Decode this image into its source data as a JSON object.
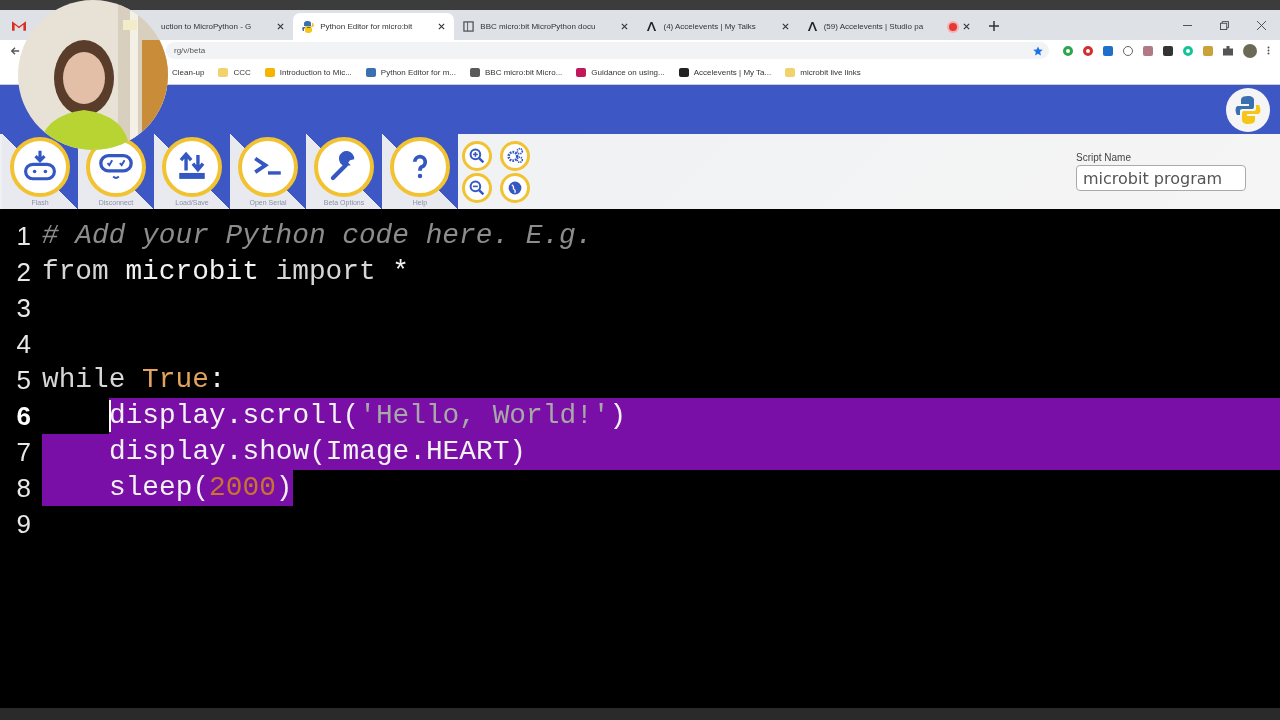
{
  "browser": {
    "tabs": [
      {
        "title": "uction to MicroPython - G",
        "kind": "slides",
        "selected": false,
        "recording": false
      },
      {
        "title": "Python Editor for micro:bit",
        "kind": "python",
        "selected": true,
        "recording": false
      },
      {
        "title": "BBC micro:bit MicroPython docu",
        "kind": "docs",
        "selected": false,
        "recording": false
      },
      {
        "title": "(4) Accelevents | My Talks",
        "kind": "accelevents",
        "selected": false,
        "recording": false
      },
      {
        "title": "(59) Accelevents | Studio pa",
        "kind": "accelevents",
        "selected": false,
        "recording": true
      }
    ],
    "address": "rg/v/beta",
    "bookmarks": [
      {
        "label": "Clean-up",
        "kind": "plain"
      },
      {
        "label": "CCC",
        "kind": "folder"
      },
      {
        "label": "Introduction to Mic...",
        "kind": "slides"
      },
      {
        "label": "Python Editor for m...",
        "kind": "python"
      },
      {
        "label": "BBC micro:bit Micro...",
        "kind": "docs"
      },
      {
        "label": "Guidance on using...",
        "kind": "link"
      },
      {
        "label": "Accelevents | My Ta...",
        "kind": "accelevents"
      },
      {
        "label": "microbit live links",
        "kind": "folder"
      }
    ]
  },
  "toolbar": {
    "buttons": [
      {
        "label": "Flash",
        "kind": "flash"
      },
      {
        "label": "Disconnect",
        "kind": "robot"
      },
      {
        "label": "Load/Save",
        "kind": "loadsave"
      },
      {
        "label": "Open Serial",
        "kind": "serial"
      },
      {
        "label": "Beta Options",
        "kind": "wrench"
      },
      {
        "label": "Help",
        "kind": "help"
      }
    ],
    "small_buttons": [
      {
        "kind": "zoom-in"
      },
      {
        "kind": "settings"
      },
      {
        "kind": "zoom-out"
      },
      {
        "kind": "globe"
      }
    ],
    "script_name": {
      "label": "Script Name",
      "value": "microbit program"
    }
  },
  "editor": {
    "lines": [
      {
        "number": "1",
        "indent": false,
        "selected": false,
        "cursor": false,
        "tokens": [
          {
            "text": "# Add your Python code here. E.g.",
            "kind": "comment"
          }
        ]
      },
      {
        "number": "2",
        "indent": false,
        "selected": false,
        "cursor": false,
        "tokens": [
          {
            "text": "from",
            "kind": "keyword"
          },
          {
            "text": " microbit ",
            "kind": "name"
          },
          {
            "text": "import",
            "kind": "keyword"
          },
          {
            "text": " *",
            "kind": "name"
          }
        ]
      },
      {
        "number": "3",
        "selected": false,
        "cursor": false
      },
      {
        "number": "4",
        "selected": false,
        "cursor": false
      },
      {
        "number": "5",
        "indent": false,
        "selected": false,
        "cursor": false,
        "tokens": [
          {
            "text": "while",
            "kind": "keyword"
          },
          {
            "text": " True",
            "kind": "constant"
          },
          {
            "text": ":",
            "kind": "name"
          }
        ]
      },
      {
        "number": "6",
        "indent": true,
        "selected": true,
        "cursor": true,
        "tokens": [
          {
            "text": "display.scroll(",
            "kind": "name"
          },
          {
            "text": "'Hello, World!'",
            "kind": "string"
          },
          {
            "text": ")",
            "kind": "name"
          }
        ]
      },
      {
        "number": "7",
        "indent": true,
        "selected": true,
        "cursor": false,
        "tokens": [
          {
            "text": "display.show(Image.HEART)",
            "kind": "name"
          }
        ]
      },
      {
        "number": "8",
        "indent": true,
        "selected": true,
        "cursor": false,
        "tokens": [
          {
            "text": "sleep(",
            "kind": "name"
          },
          {
            "text": "2000",
            "kind": "number"
          },
          {
            "text": ")",
            "kind": "name"
          }
        ]
      },
      {
        "number": "9",
        "selected": false,
        "cursor": false
      }
    ]
  }
}
